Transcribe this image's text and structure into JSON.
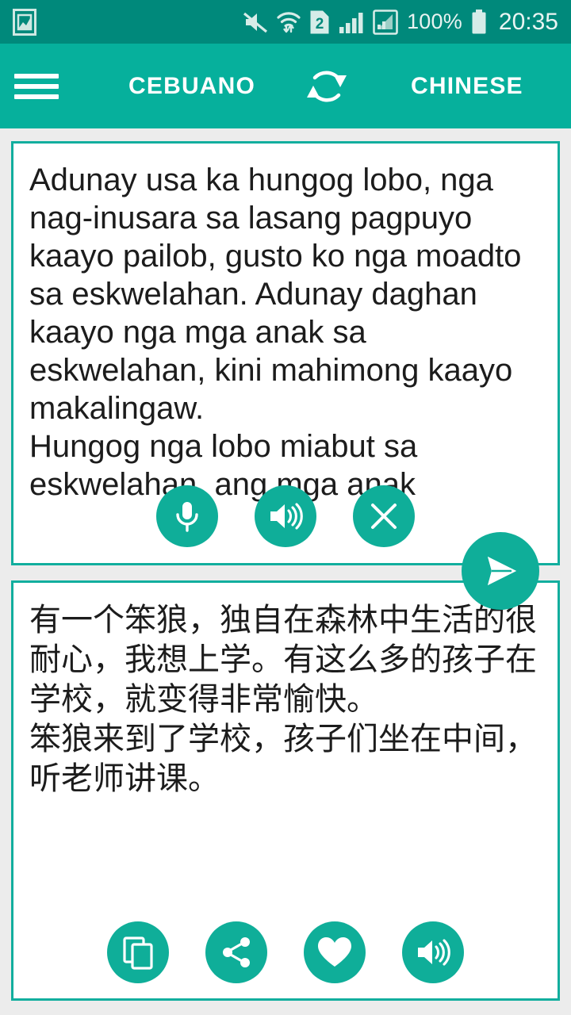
{
  "statusbar": {
    "left_icons": [
      {
        "name": "screenshot-image-icon",
        "glyph": "image"
      }
    ],
    "right_icons": [
      {
        "name": "mute-icon",
        "glyph": "muted-speaker"
      },
      {
        "name": "wifi-data-icon",
        "glyph": "wifi-arrows"
      },
      {
        "name": "sim2-icon",
        "glyph": "sim-card-2",
        "label": "2"
      },
      {
        "name": "signal-bars-icon",
        "glyph": "signal-bars"
      },
      {
        "name": "signal-bars-boxed-icon",
        "glyph": "signal-bars-boxed"
      }
    ],
    "battery_percent": "100%",
    "clock": "20:35"
  },
  "appbar": {
    "menu_label": "menu",
    "source_language": "CEBUANO",
    "target_language": "CHINESE",
    "swap_label": "swap languages"
  },
  "source_card": {
    "text": "Adunay usa ka hungog lobo, nga nag-inusara sa lasang pagpuyo kaayo pailob, gusto ko nga moadto sa eskwelahan. Adunay daghan kaayo nga mga anak sa eskwelahan, kini mahimong kaayo makalingaw.\nHungog nga lobo miabut sa eskwelahan, ang mga anak",
    "buttons": [
      {
        "name": "microphone-button",
        "label": "Voice input"
      },
      {
        "name": "speak-source-button",
        "label": "Speak"
      },
      {
        "name": "clear-button",
        "label": "Clear"
      }
    ]
  },
  "translate_button": {
    "name": "send-translate-button",
    "label": "Translate"
  },
  "target_card": {
    "text": "有一个笨狼，独自在森林中生活的很耐心，我想上学。有这么多的孩子在学校，就变得非常愉快。\n笨狼来到了学校，孩子们坐在中间，听老师讲课。",
    "buttons": [
      {
        "name": "copy-button",
        "label": "Copy"
      },
      {
        "name": "share-button",
        "label": "Share"
      },
      {
        "name": "favorite-button",
        "label": "Favorite"
      },
      {
        "name": "speak-target-button",
        "label": "Speak"
      }
    ]
  },
  "colors": {
    "statusbar_bg": "#00897B",
    "appbar_bg": "#06B09C",
    "accent": "#0FAE99",
    "card_border": "#12AE9E",
    "page_bg": "#ECECEC",
    "text": "#1C1C1C"
  }
}
